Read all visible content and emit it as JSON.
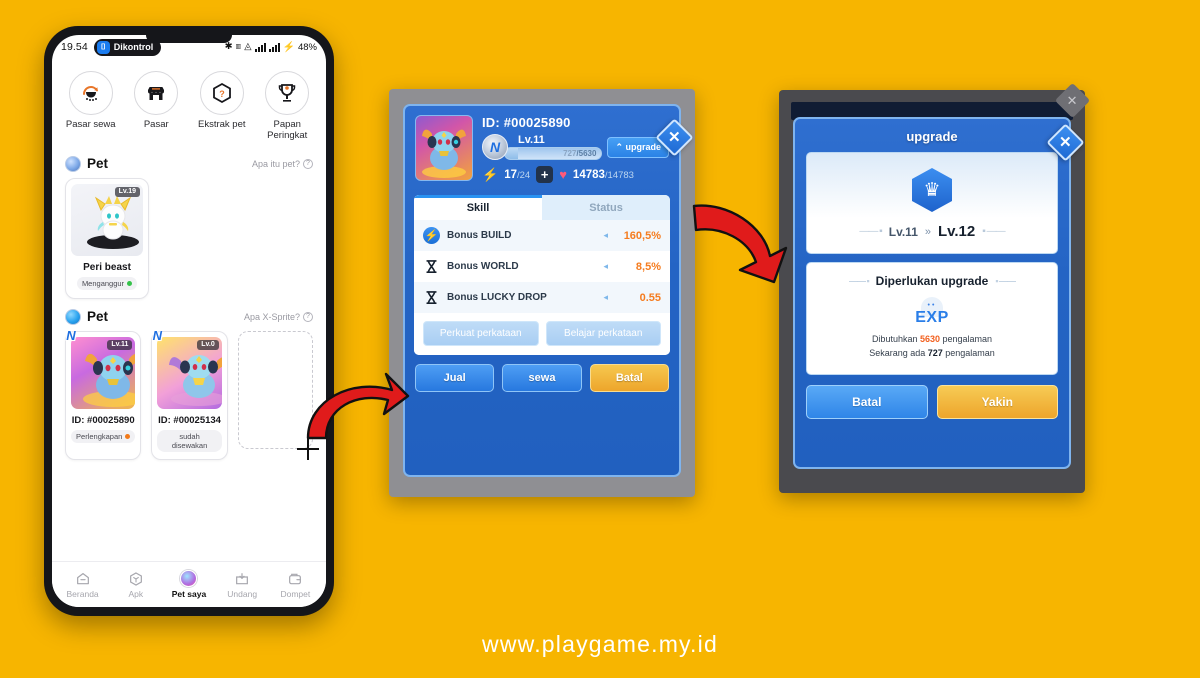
{
  "watermark": "www.playgame.my.id",
  "phone": {
    "statusbar": {
      "time": "19.54",
      "pill_label": "Dikontrol",
      "pill_icon": "cast-icon",
      "battery": "48%",
      "icons": [
        "bluetooth-icon",
        "data-4g-icon",
        "wifi-icon",
        "signal-icon",
        "signal-icon",
        "charging-bolt-icon"
      ]
    },
    "quick_actions": [
      {
        "label": "Pasar sewa",
        "icon": "rental-market-icon"
      },
      {
        "label": "Pasar",
        "icon": "store-icon"
      },
      {
        "label": "Ekstrak pet",
        "icon": "extract-box-icon"
      },
      {
        "label": "Papan Peringkat",
        "icon": "trophy-icon"
      }
    ],
    "sections": [
      {
        "title": "Pet",
        "help": "Apa itu pet?",
        "cards": [
          {
            "level": "Lv.19",
            "name": "Peri beast",
            "status": "Menganggur",
            "status_dot": "green"
          }
        ]
      },
      {
        "title": "Pet",
        "help": "Apa X-Sprite?",
        "cards": [
          {
            "level": "Lv.11",
            "name": "ID: #00025890",
            "status": "Perlengkapan",
            "status_dot": "orange",
            "badge": "N"
          },
          {
            "level": "Lv.0",
            "name": "ID: #00025134",
            "status": "sudah disewakan",
            "status_dot": "none",
            "badge": "N"
          }
        ]
      }
    ],
    "bottom_nav": [
      {
        "label": "Beranda",
        "icon": "home-icon",
        "active": false
      },
      {
        "label": "Apk",
        "icon": "apps-icon",
        "active": false
      },
      {
        "label": "Pet saya",
        "icon": "pet-avatar-icon",
        "active": true
      },
      {
        "label": "Undang",
        "icon": "invite-icon",
        "active": false
      },
      {
        "label": "Dompet",
        "icon": "wallet-icon",
        "active": false
      }
    ]
  },
  "detail_dialog": {
    "close_label": "✕",
    "pet_id": "ID: #00025890",
    "level": "Lv.11",
    "xp_current": "727",
    "xp_separator": "/",
    "xp_max": "5630",
    "upgrade_button": "⌃ upgrade",
    "energy": "17",
    "energy_max": "/24",
    "plus": "+",
    "hp": "14783",
    "hp_max": "/14783",
    "tabs": [
      {
        "label": "Skill",
        "active": true
      },
      {
        "label": "Status",
        "active": false
      }
    ],
    "skills": [
      {
        "icon": "bolt-circle-icon",
        "name": "Bonus BUILD",
        "value": "160,5%"
      },
      {
        "icon": "hourglass-icon",
        "name": "Bonus WORLD",
        "value": "8,5%"
      },
      {
        "icon": "hourglass-icon",
        "name": "Bonus LUCKY DROP",
        "value": "0.55"
      }
    ],
    "word_buttons": [
      "Perkuat perkataan",
      "Belajar perkataan"
    ],
    "actions": [
      {
        "label": "Jual",
        "style": "blue"
      },
      {
        "label": "sewa",
        "style": "blue"
      },
      {
        "label": "Batal",
        "style": "orange"
      }
    ]
  },
  "upgrade_dialog": {
    "close_label": "✕",
    "title": "upgrade",
    "crown_icon": "crown-hex-icon",
    "level_from": "Lv.11",
    "level_chevron": "»",
    "level_to": "Lv.12",
    "required_title": "Diperlukan upgrade",
    "exp_label": "EXP",
    "required_prefix": "Dibutuhkan ",
    "required_value": "5630",
    "required_suffix": " pengalaman",
    "current_prefix": "Sekarang ada ",
    "current_value": "727",
    "current_suffix": " pengalaman",
    "actions": [
      {
        "label": "Batal",
        "style": "blue"
      },
      {
        "label": "Yakin",
        "style": "orange"
      }
    ]
  },
  "colors": {
    "background": "#F7B500",
    "accent_blue": "#2a82e6",
    "accent_orange": "#f57c1f",
    "arrow_red": "#e01b1b"
  }
}
